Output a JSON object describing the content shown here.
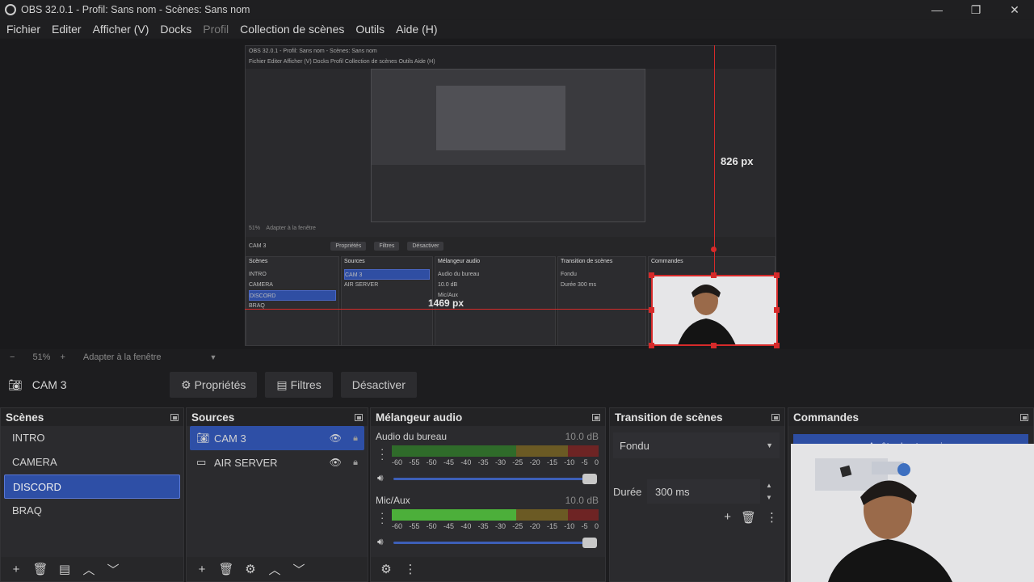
{
  "window": {
    "title": "OBS 32.0.1 - Profil: Sans nom - Scènes: Sans nom",
    "controls": [
      "—",
      "❐",
      "✕"
    ]
  },
  "menu": {
    "items": [
      "Fichier",
      "Editer",
      "Afficher (V)",
      "Docks",
      "Profil",
      "Collection de scènes",
      "Outils",
      "Aide (H)"
    ],
    "disabled": [
      "Profil"
    ]
  },
  "preview": {
    "guide_vertical_label": "826 px",
    "guide_horizontal_label": "1469 px",
    "inner_title": "OBS 32.0.1 - Profil: Sans nom - Scènes: Sans nom",
    "inner_menu": "Fichier  Editer  Afficher (V)  Docks  Profil  Collection de scènes  Outils  Aide (H)",
    "inner_source": "CAM 3",
    "inner_buttons": [
      "Propriétés",
      "Filtres",
      "Désactiver"
    ],
    "inner_docks": [
      "Scènes",
      "Sources",
      "Mélangeur audio",
      "Transition de scènes",
      "Commandes"
    ],
    "inner_scenes": [
      "INTRO",
      "CAMERA",
      "DISCORD",
      "BRAQ"
    ],
    "inner_sources": [
      "CAM 3",
      "AIR SERVER"
    ],
    "inner_audio": [
      "Audio du bureau",
      "Mic/Aux"
    ],
    "inner_db": "10.0 dB",
    "inner_transition": "Fondu",
    "inner_duration_label": "Durée",
    "inner_duration": "300 ms",
    "inner_zoom": "51%",
    "inner_fit": "Adapter à la fenêtre"
  },
  "zoom": {
    "minus": "−",
    "value": "51%",
    "plus": "+",
    "fit": "Adapter à la fenêtre"
  },
  "source_toolbar": {
    "current_source": "CAM 3",
    "properties": "Propriétés",
    "filters": "Filtres",
    "deactivate": "Désactiver"
  },
  "scenes": {
    "title": "Scènes",
    "items": [
      "INTRO",
      "CAMERA",
      "DISCORD",
      "BRAQ"
    ],
    "selected": "DISCORD"
  },
  "sources": {
    "title": "Sources",
    "items": [
      {
        "name": "CAM 3",
        "icon": "camera-icon",
        "selected": true
      },
      {
        "name": "AIR SERVER",
        "icon": "monitor-icon",
        "selected": false
      }
    ]
  },
  "mixer": {
    "title": "Mélangeur audio",
    "channels": [
      {
        "name": "Audio du bureau",
        "db": "10.0 dB",
        "level": 0.0,
        "volume": 1.0
      },
      {
        "name": "Mic/Aux",
        "db": "10.0 dB",
        "level": 0.6,
        "volume": 1.0
      }
    ],
    "scale": [
      "-60",
      "-55",
      "-50",
      "-45",
      "-40",
      "-35",
      "-30",
      "-25",
      "-20",
      "-15",
      "-10",
      "-5",
      "0"
    ]
  },
  "transitions": {
    "title": "Transition de scènes",
    "selected": "Fondu",
    "duration_label": "Durée",
    "duration": "300 ms"
  },
  "controls": {
    "title": "Commandes",
    "stop_streaming": "Arrêter le streaming"
  },
  "colors": {
    "accent": "#2e4fa6",
    "guide": "#d62a2a",
    "meter_green": "#2f6b2a",
    "meter_yellow": "#6b5a24",
    "meter_red": "#6e2424"
  }
}
